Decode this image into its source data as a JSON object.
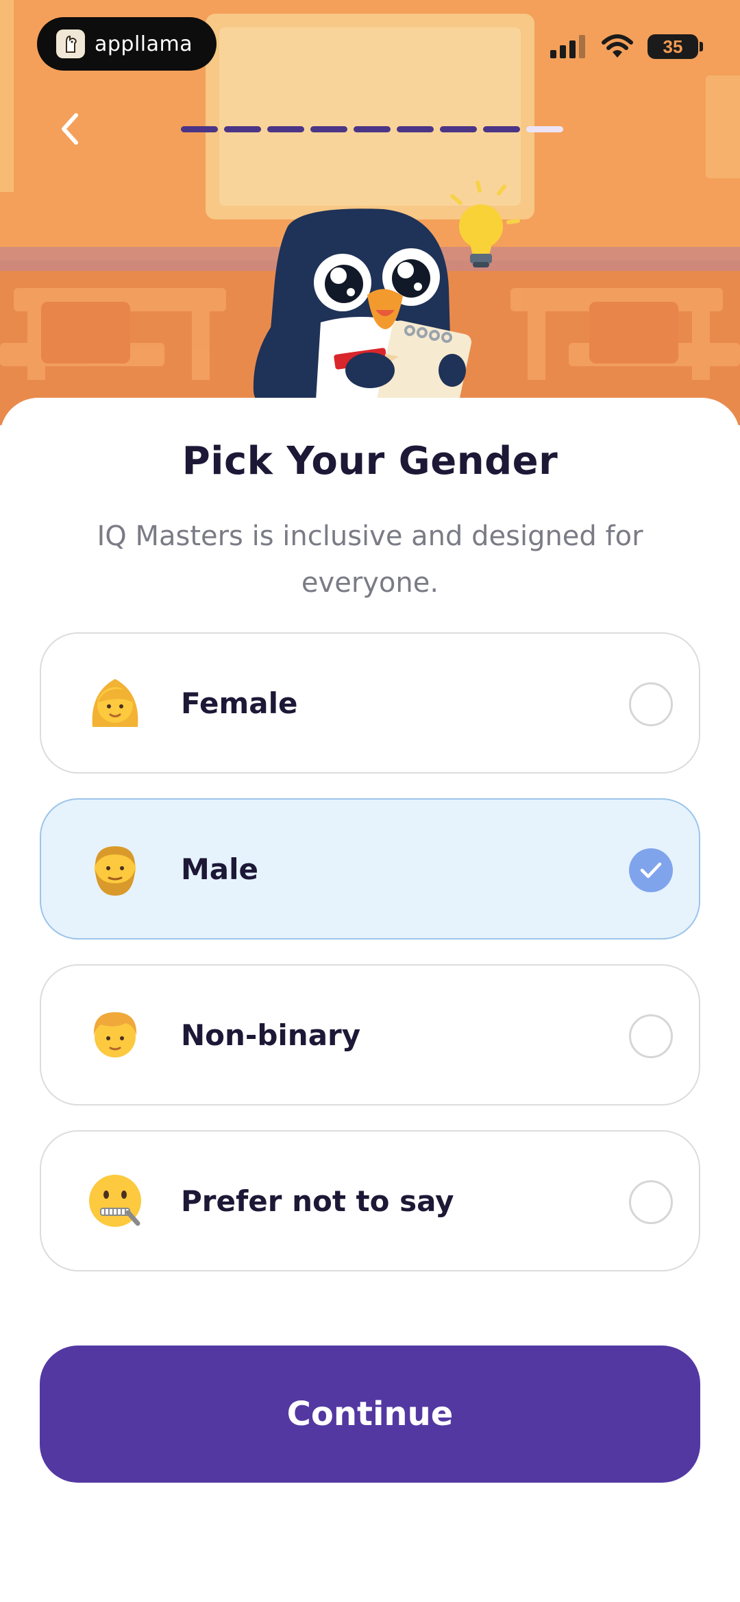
{
  "status_bar": {
    "brand_name": "appllama",
    "battery_level": "35",
    "icons": [
      "signal-icon",
      "wifi-icon",
      "battery-icon"
    ]
  },
  "nav": {
    "back_icon": "chevron-left-icon",
    "progress": {
      "completed_steps": 8,
      "total_steps": 9
    }
  },
  "page": {
    "title": "Pick Your Gender",
    "subtitle": "IQ Masters is inclusive and designed for everyone."
  },
  "options": [
    {
      "label": "Female",
      "icon": "woman-emoji-icon",
      "selected": false
    },
    {
      "label": "Male",
      "icon": "bearded-man-emoji-icon",
      "selected": true
    },
    {
      "label": "Non-binary",
      "icon": "person-emoji-icon",
      "selected": false
    },
    {
      "label": "Prefer not to say",
      "icon": "zipper-mouth-emoji-icon",
      "selected": false
    }
  ],
  "continue_label": "Continue",
  "colors": {
    "accent": "#5338A2",
    "progress_done": "#4B3586",
    "selected_bg": "#E6F3FD",
    "check": "#7FA4EC",
    "title": "#1C1836"
  }
}
